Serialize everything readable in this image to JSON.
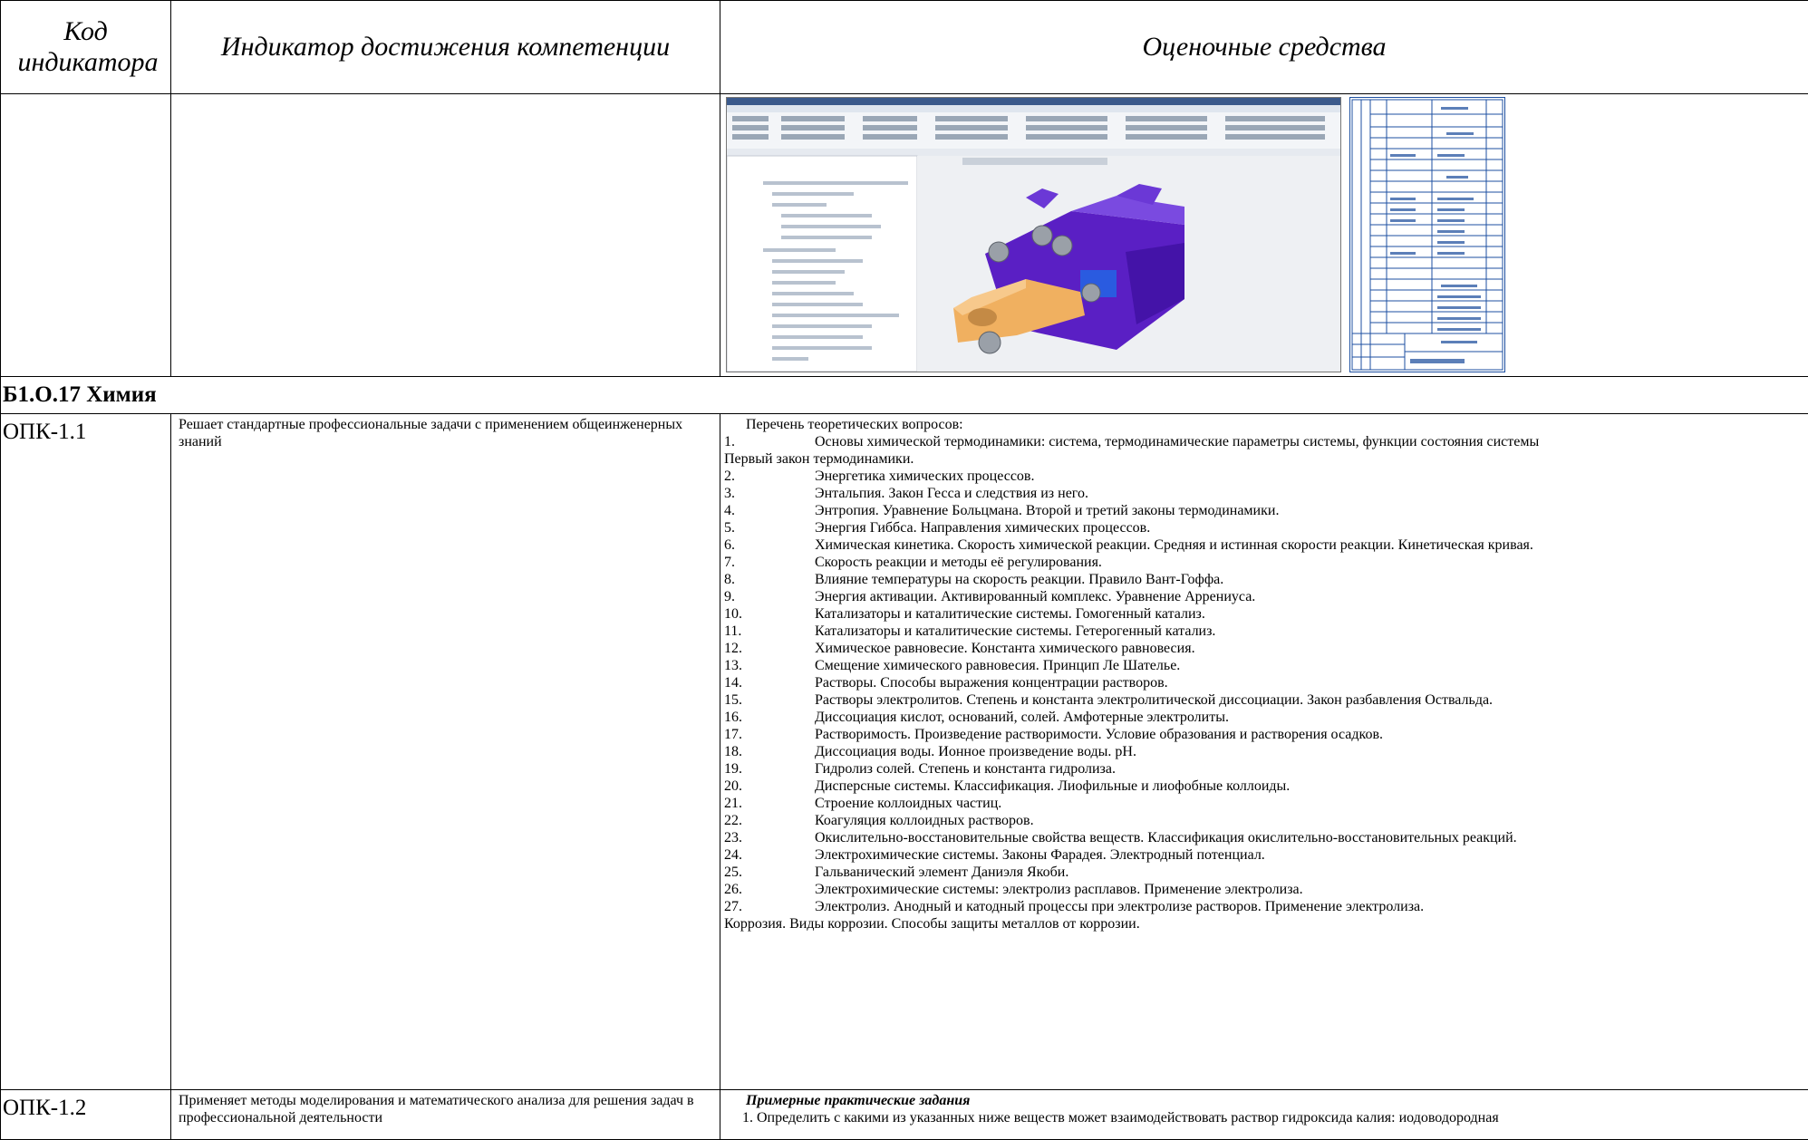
{
  "header": {
    "code_col": "Код индикатора",
    "indicator_col": "Индикатор достижения компетенции",
    "eval_col": "Оценочные средства"
  },
  "section": {
    "title": "Б1.О.17 Химия"
  },
  "rows": [
    {
      "code": "ОПК-1.1",
      "indicator": "Решает стандартные профессиональные задачи с применением общеинженерных знаний",
      "intro": "Перечень теоретических вопросов:",
      "q1_num": "1.",
      "q1_text": "Основы химической термодинамики: система, термодинамические параметры системы, функции состояния системы",
      "q1_cont": "Первый закон термодинамики.",
      "questions": [
        {
          "n": "2.",
          "t": "Энергетика химических процессов."
        },
        {
          "n": "3.",
          "t": "Энтальпия. Закон Гесса и следствия из него."
        },
        {
          "n": "4.",
          "t": "Энтропия. Уравнение Больцмана. Второй и третий законы термодинамики."
        },
        {
          "n": "5.",
          "t": "Энергия Гиббса. Направления химических процессов."
        },
        {
          "n": "6.",
          "t": "Химическая кинетика. Скорость химической реакции. Средняя и истинная скорости реакции. Кинетическая кривая."
        },
        {
          "n": "7.",
          "t": "Скорость реакции и методы её регулирования."
        },
        {
          "n": "8.",
          "t": "Влияние температуры на скорость реакции. Правило Вант-Гоффа."
        },
        {
          "n": "9.",
          "t": "Энергия активации. Активированный комплекс. Уравнение Аррениуса."
        },
        {
          "n": "10.",
          "t": "Катализаторы и каталитические системы. Гомогенный катализ."
        },
        {
          "n": "11.",
          "t": "Катализаторы и каталитические системы. Гетерогенный катализ."
        },
        {
          "n": "12.",
          "t": "Химическое равновесие. Константа химического равновесия."
        },
        {
          "n": "13.",
          "t": "Смещение химического равновесия. Принцип Ле Шателье."
        },
        {
          "n": "14.",
          "t": "Растворы. Способы выражения концентрации растворов."
        },
        {
          "n": "15.",
          "t": "Растворы электролитов. Степень и константа электролитической диссоциации. Закон разбавления Оствальда."
        },
        {
          "n": "16.",
          "t": "Диссоциация кислот, оснований, солей. Амфотерные электролиты."
        },
        {
          "n": "17.",
          "t": "Растворимость. Произведение растворимости. Условие образования и растворения осадков."
        },
        {
          "n": "18.",
          "t": "Диссоциация воды. Ионное произведение воды. pH."
        },
        {
          "n": "19.",
          "t": "Гидролиз солей. Степень и константа гидролиза."
        },
        {
          "n": "20.",
          "t": "Дисперсные системы. Классификация. Лиофильные и лиофобные коллоиды."
        },
        {
          "n": "21.",
          "t": "Строение коллоидных частиц."
        },
        {
          "n": "22.",
          "t": "Коагуляция коллоидных растворов."
        },
        {
          "n": "23.",
          "t": "Окислительно-восстановительные свойства веществ. Классификация окислительно-восстановительных реакций."
        },
        {
          "n": "24.",
          "t": "Электрохимические системы. Законы Фарадея. Электродный потенциал."
        },
        {
          "n": "25.",
          "t": "Гальванический элемент Даниэля Якоби."
        },
        {
          "n": "26.",
          "t": "Электрохимические системы: электролиз расплавов. Применение электролиза."
        },
        {
          "n": "27.",
          "t": "Электролиз. Анодный и катодный процессы при электролизе растворов. Применение электролиза."
        }
      ],
      "q27_cont": "Коррозия. Виды коррозии. Способы защиты металлов от коррозии."
    },
    {
      "code": "ОПК-1.2",
      "indicator": "Применяет методы моделирования и математического анализа для решения задач в профессиональной деятельности",
      "prac_title": "Примерные практические задания",
      "prac_1": "1. Определить с какими из указанных ниже веществ может взаимодействовать раствор гидроксида калия: иодоводородная"
    }
  ],
  "colors": {
    "border": "#000000",
    "cad_part_purple": "#5a1fc4",
    "cad_part_orange": "#f0b060",
    "cad_bg": "#e9ecef",
    "spec_lines": "#1c4fa0"
  }
}
